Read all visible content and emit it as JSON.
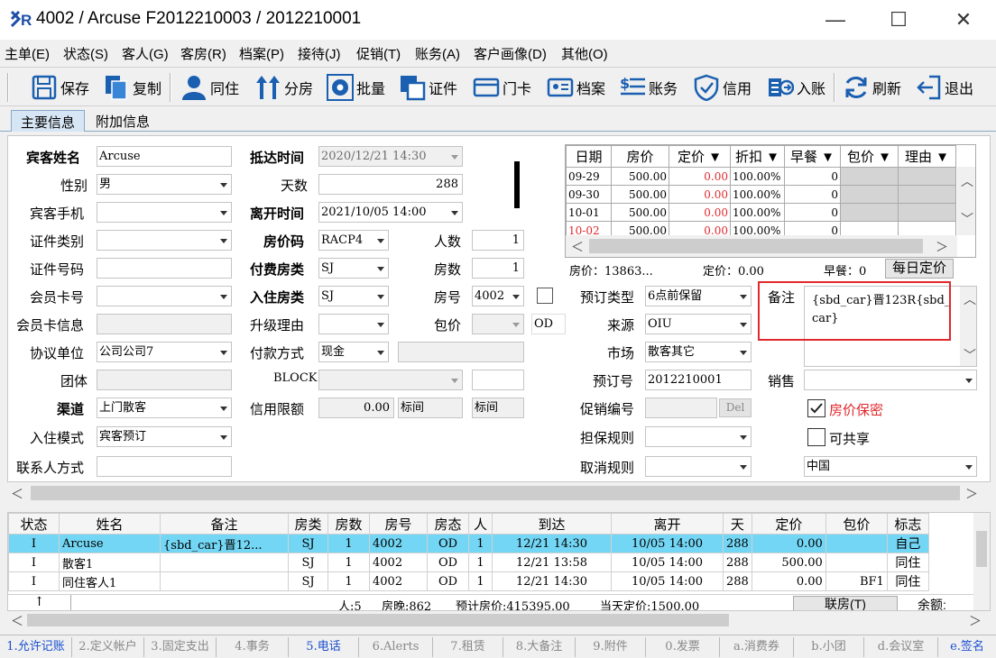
{
  "window": {
    "title": "4002 / Arcuse  F2012210003 / 2012210001",
    "minimize": "—",
    "maximize": "☐",
    "close": "✕"
  },
  "menu": [
    "主单(E)",
    "状态(S)",
    "客人(G)",
    "客房(R)",
    "档案(P)",
    "接待(J)",
    "促销(T)",
    "账务(A)",
    "客户画像(D)",
    "其他(O)"
  ],
  "toolbar": [
    "保存",
    "复制",
    "同住",
    "分房",
    "批量",
    "证件",
    "门卡",
    "档案",
    "账务",
    "信用",
    "入账",
    "刷新",
    "退出"
  ],
  "tabs": [
    "主要信息",
    "附加信息"
  ],
  "form": {
    "guest_name_label": "宾客姓名",
    "guest_name": "Arcuse",
    "gender_label": "性别",
    "gender": "男",
    "mobile_label": "宾客手机",
    "mobile": "",
    "id_type_label": "证件类别",
    "id_type": "",
    "id_no_label": "证件号码",
    "id_no": "",
    "member_card_label": "会员卡号",
    "member_card": "",
    "member_info_label": "会员卡信息",
    "member_info": "",
    "agreement_label": "协议单位",
    "agreement": "公司公司7",
    "group_label": "团体",
    "group": "",
    "channel_label": "渠道",
    "channel": "上门散客",
    "checkin_mode_label": "入住模式",
    "checkin_mode": "宾客预订",
    "contact_label": "联系人方式",
    "contact": "",
    "arrival_label": "抵达时间",
    "arrival": "2020/12/21 14:30",
    "days_label": "天数",
    "days": "288",
    "departure_label": "离开时间",
    "departure": "2021/10/05 14:00",
    "rate_code_label": "房价码",
    "rate_code": "RACP4",
    "persons_label": "人数",
    "persons": "1",
    "pay_room_label": "付费房类",
    "pay_room": "SJ",
    "rooms_label": "房数",
    "rooms": "1",
    "stay_room_label": "入住房类",
    "stay_room": "SJ",
    "room_no_label": "房号",
    "room_no": "4002",
    "upgrade_label": "升级理由",
    "upgrade": "",
    "package_label": "包价",
    "package": "",
    "od": "OD",
    "payment_label": "付款方式",
    "payment": "现金",
    "block_label": "BLOCK",
    "block": "",
    "credit_label": "信用限额",
    "credit": "0.00",
    "std1": "标间",
    "std2": "标间",
    "booking_type_label": "预订类型",
    "booking_type": "6点前保留",
    "source_label": "来源",
    "source": "OIU",
    "market_label": "市场",
    "market": "散客其它",
    "booking_no_label": "预订号",
    "booking_no": "2012210001",
    "promo_label": "促销编号",
    "promo": "",
    "del_button": "Del",
    "guarantee_label": "担保规则",
    "guarantee": "",
    "cancel_label": "取消规则",
    "cancel": "",
    "remark_label": "备注",
    "remark": "{sbd_car}晋123R{sbd_car}",
    "sales_label": "销售",
    "sales": "",
    "price_secret": "房价保密",
    "shareable": "可共享",
    "country": "中国",
    "rate_summary": "房价：13863...",
    "fixed_summary": "定价：0.00",
    "breakfast_summary": "早餐：0",
    "daily_rate_button": "每日定价"
  },
  "mini_grid": {
    "headers": [
      "日期",
      "房价",
      "定价 ▼",
      "折扣 ▼",
      "早餐 ▼",
      "包价 ▼",
      "理由 ▼"
    ],
    "rows": [
      [
        "09-29",
        "500.00",
        "0.00",
        "100.00%",
        "0",
        "",
        ""
      ],
      [
        "09-30",
        "500.00",
        "0.00",
        "100.00%",
        "0",
        "",
        ""
      ],
      [
        "10-01",
        "500.00",
        "0.00",
        "100.00%",
        "0",
        "",
        ""
      ],
      [
        "10-02",
        "500.00",
        "0.00",
        "100.00%",
        "0",
        "",
        ""
      ]
    ]
  },
  "grid": {
    "headers": [
      "状态",
      "姓名",
      "备注",
      "房类",
      "房数",
      "房号",
      "房态",
      "人",
      "到达",
      "离开",
      "天",
      "定价",
      "包价",
      "标志"
    ],
    "rows": [
      [
        "I",
        "Arcuse",
        "{sbd_car}晋12...",
        "SJ",
        "1",
        "4002",
        "OD",
        "1",
        "12/21 14:30",
        "10/05 14:00",
        "288",
        "0.00",
        "",
        "自己"
      ],
      [
        "I",
        "散客1",
        "",
        "SJ",
        "1",
        "4002",
        "OD",
        "1",
        "12/21 13:58",
        "10/05 14:00",
        "288",
        "500.00",
        "",
        "同住"
      ],
      [
        "I",
        "同住客人1",
        "",
        "SJ",
        "1",
        "4002",
        "OD",
        "1",
        "12/21 14:30",
        "10/05 14:00",
        "288",
        "0.00",
        "BF1",
        "同住"
      ]
    ],
    "footer_persons": "人:5",
    "footer_nights": "房晚:862",
    "footer_estimate": "预计房价:415395.00",
    "footer_today": "当天定价:1500.00",
    "link_room_button": "联房(T)",
    "balance": "余额:"
  },
  "bottom_tabs": [
    "1.允许记账",
    "2.定义帐户",
    "3.固定支出",
    "4.事务",
    "5.电话",
    "6.Alerts",
    "7.租赁",
    "8.大备注",
    "9.附件",
    "0.发票",
    "a.消费券",
    "b.小团",
    "d.会议室",
    "e.签名"
  ]
}
